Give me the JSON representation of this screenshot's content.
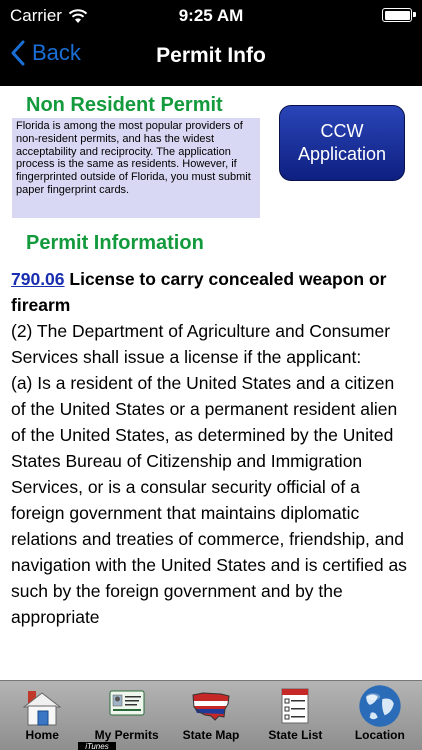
{
  "status_bar": {
    "carrier": "Carrier",
    "time": "9:25 AM"
  },
  "nav": {
    "back_label": "Back",
    "title": "Permit Info"
  },
  "permit": {
    "header": "Non Resident Permit",
    "summary": "Florida is among the most popular providers of non-resident permits, and has the widest acceptability and reciprocity. The application process is the same as residents.  However, if fingerprinted outside of Florida, you must submit paper fingerprint cards.",
    "ccw_button_line1": "CCW",
    "ccw_button_line2": "Application"
  },
  "section": {
    "title": "Permit Information"
  },
  "statute": {
    "ref": "790.06",
    "heading": " License to carry concealed weapon or firearm",
    "p1": "(2) The Department of Agriculture and Consumer Services shall issue a license if the applicant:",
    "p2": "(a) Is a resident of the United States and a citizen of the United States or a permanent resident alien of the United States, as determined by the United States Bureau of Citizenship and Immigration Services, or is a consular security official of a foreign government that maintains diplomatic relations and treaties of commerce, friendship, and navigation with the United States and is certified as such by the foreign government and by the appropriate"
  },
  "tabs": [
    {
      "label": "Home",
      "icon": "home-icon"
    },
    {
      "label": "My Permits",
      "icon": "permits-icon"
    },
    {
      "label": "State Map",
      "icon": "us-map-icon"
    },
    {
      "label": "State List",
      "icon": "state-list-icon"
    },
    {
      "label": "Location",
      "icon": "globe-icon"
    }
  ],
  "itunes_badge": "iTunes"
}
